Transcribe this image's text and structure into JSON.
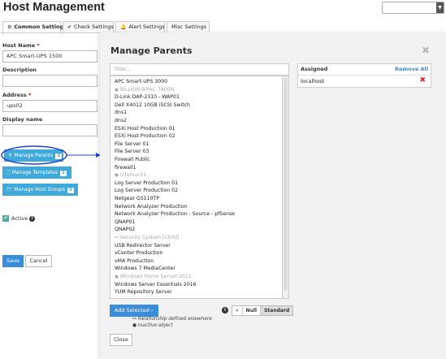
{
  "page_title": "Host Management",
  "colors": {
    "accent": "#3fa9d9",
    "primary": "#3a8dd9",
    "remove": "#dd2233",
    "highlight_ring": "#2244cc"
  },
  "tabs": [
    {
      "label": "Common Settings",
      "icon": "gear-icon",
      "active": true
    },
    {
      "label": "Check Settings",
      "icon": "check-icon",
      "active": false
    },
    {
      "label": "Alert Settings",
      "icon": "bell-icon",
      "active": false
    },
    {
      "label": "Misc Settings",
      "icon": "",
      "active": false
    }
  ],
  "form": {
    "host_name": {
      "label": "Host Name",
      "required_mark": "*",
      "value": "APC Smart-UPS 1500"
    },
    "description": {
      "label": "Description",
      "value": ""
    },
    "address": {
      "label": "Address",
      "required_mark": "*",
      "value": "ups02"
    },
    "display_name": {
      "label": "Display name",
      "value": ""
    },
    "manage_parents": {
      "label": "Manage Parents",
      "count": "0",
      "icon": "sitemap-icon"
    },
    "manage_templates": {
      "label": "Manage Templates",
      "count": "1",
      "icon": "file-icon"
    },
    "manage_host_groups": {
      "label": "Manage Host Groups",
      "count": "0",
      "icon": "folder-icon"
    },
    "active": {
      "label": "Active",
      "checked": true
    },
    "save_label": "Save",
    "cancel_label": "Cancel"
  },
  "modal": {
    "title": "Manage Parents",
    "close_glyph": "✖",
    "filter_placeholder": "Filter...",
    "items": [
      {
        "label": "APC Smart-UPS 3000",
        "inactive": false,
        "mark": ""
      },
      {
        "label": "BILLION BIPAC 7800N",
        "inactive": true,
        "mark": "info"
      },
      {
        "label": "D-Link DAP-2310 - WAP01",
        "inactive": false,
        "mark": ""
      },
      {
        "label": "Dell X4012 10GB iSCSI Switch",
        "inactive": false,
        "mark": ""
      },
      {
        "label": "dns1",
        "inactive": false,
        "mark": ""
      },
      {
        "label": "dns2",
        "inactive": false,
        "mark": ""
      },
      {
        "label": "ESXi Host Production 01",
        "inactive": false,
        "mark": ""
      },
      {
        "label": "ESXi Host Production 02",
        "inactive": false,
        "mark": ""
      },
      {
        "label": "File Server 01",
        "inactive": false,
        "mark": ""
      },
      {
        "label": "File Server 03",
        "inactive": false,
        "mark": ""
      },
      {
        "label": "Firewall Public",
        "inactive": false,
        "mark": ""
      },
      {
        "label": "firewall1",
        "inactive": false,
        "mark": ""
      },
      {
        "label": "intelnuc01",
        "inactive": true,
        "mark": "info"
      },
      {
        "label": "Log Server Production 01",
        "inactive": false,
        "mark": ""
      },
      {
        "label": "Log Server Production 02",
        "inactive": false,
        "mark": ""
      },
      {
        "label": "Netgear GS110TP",
        "inactive": false,
        "mark": ""
      },
      {
        "label": "Network Analyzer Production",
        "inactive": false,
        "mark": ""
      },
      {
        "label": "Network Analyzer Production - Source - pfSense",
        "inactive": false,
        "mark": ""
      },
      {
        "label": "QNAP01",
        "inactive": false,
        "mark": ""
      },
      {
        "label": "QNAP02",
        "inactive": false,
        "mark": ""
      },
      {
        "label": "Security System [Child]",
        "inactive": true,
        "mark": "link"
      },
      {
        "label": "USB Redirector Server",
        "inactive": false,
        "mark": ""
      },
      {
        "label": "vCenter Production",
        "inactive": false,
        "mark": ""
      },
      {
        "label": "vMA Production",
        "inactive": false,
        "mark": ""
      },
      {
        "label": "Windows 7 MediaCenter",
        "inactive": false,
        "mark": ""
      },
      {
        "label": "Windows Home Server 2011",
        "inactive": true,
        "mark": "info"
      },
      {
        "label": "Windows Server Essentials 2016",
        "inactive": false,
        "mark": ""
      },
      {
        "label": "YUM Repository Server",
        "inactive": false,
        "mark": ""
      }
    ],
    "assigned": {
      "title": "Assigned",
      "remove_all_label": "Remove All",
      "items": [
        {
          "label": "localhost"
        }
      ]
    },
    "add_selected_label": "Add Selected",
    "legend": {
      "relationship": "Relationship defined elsewhere",
      "inactive": "Inactive object"
    },
    "toggle": {
      "options": [
        "«",
        "Null",
        "Standard"
      ],
      "selected": "Standard"
    },
    "close_label": "Close"
  }
}
